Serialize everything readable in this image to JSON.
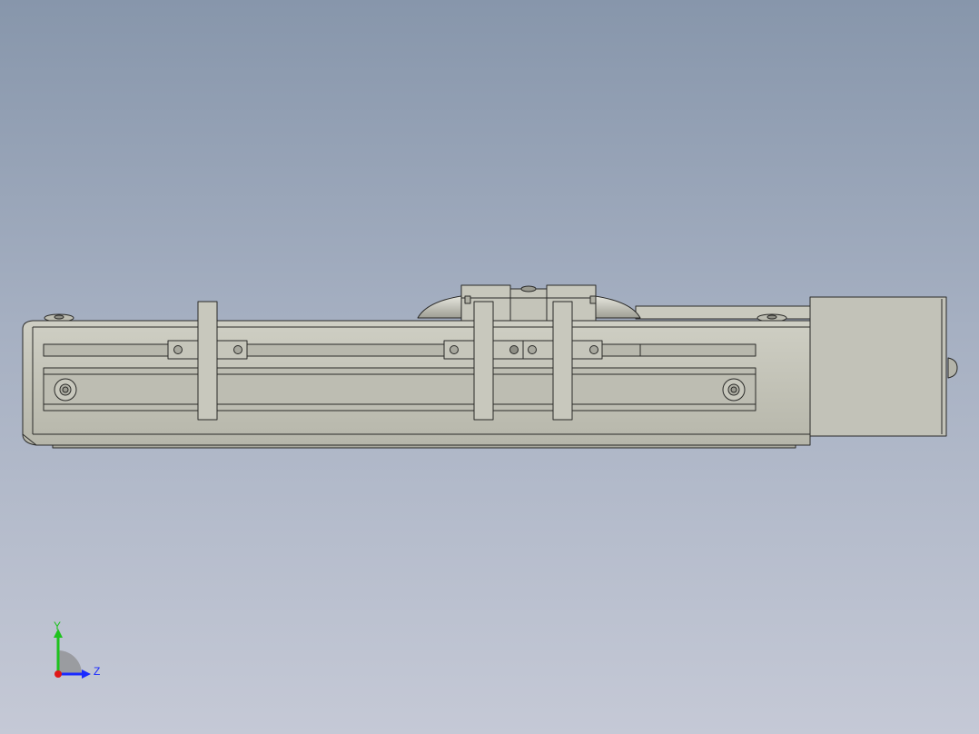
{
  "viewport": {
    "background_top": "#8796ab",
    "background_bottom": "#c5c9d6"
  },
  "model": {
    "body_color": "#c0c0b4",
    "edge_color": "#2a2a28",
    "motor_color": "#c2c2b8"
  },
  "triad": {
    "y_label": "Y",
    "z_label": "Z",
    "y_color": "#1ec21e",
    "z_color": "#1a2aff",
    "x_color": "#e01818"
  }
}
